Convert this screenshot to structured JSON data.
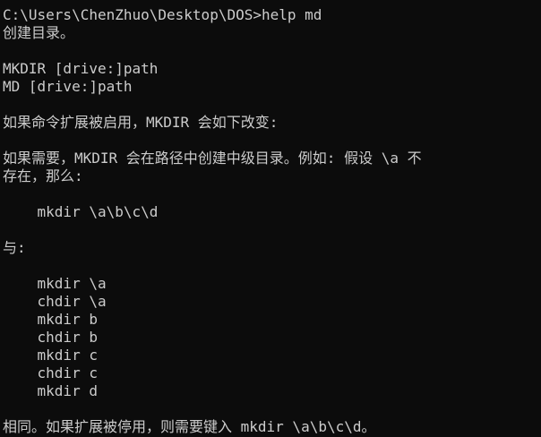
{
  "console": {
    "lines": [
      "C:\\Users\\ChenZhuo\\Desktop\\DOS>help md",
      "创建目录。",
      "",
      "MKDIR [drive:]path",
      "MD [drive:]path",
      "",
      "如果命令扩展被启用，MKDIR 会如下改变:",
      "",
      "如果需要，MKDIR 会在路径中创建中级目录。例如: 假设 \\a 不",
      "存在，那么:",
      "",
      "    mkdir \\a\\b\\c\\d",
      "",
      "与:",
      "",
      "    mkdir \\a",
      "    chdir \\a",
      "    mkdir b",
      "    chdir b",
      "    mkdir c",
      "    chdir c",
      "    mkdir d",
      "",
      "相同。如果扩展被停用，则需要键入 mkdir \\a\\b\\c\\d。"
    ]
  }
}
